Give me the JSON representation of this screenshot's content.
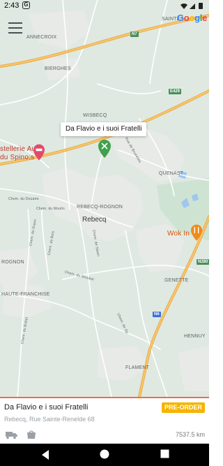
{
  "status_bar": {
    "time": "2:43",
    "notification_icon": "g-badge-icon",
    "right_icons": [
      "wifi-icon",
      "signal-icon",
      "battery-icon"
    ]
  },
  "map": {
    "attribution": "Google",
    "menu_icon": "hamburger-menu-icon",
    "places": {
      "annecroix": "ANNECROIX",
      "bierghes": "BIERGHES",
      "wisbecq": "WISBECQ",
      "saintes": "SAINTES",
      "hostellerie_line1": "stellerie Au",
      "hostellerie_line2": "du Spino:s",
      "quenast": "QUENAST",
      "rebecq_rognon": "REBECQ-ROGNON",
      "rebecq": "Rebecq",
      "rognon": "ROGNON",
      "wok_in": "Wok In",
      "genette": "GENETTE",
      "haute_franchise": "HAUTE-FRANCHISE",
      "hennuy": "HENNUY",
      "flament": "FLAMENT",
      "chem_douaire": "Chem. du Douaire",
      "chem_moulin": "Chem. du Moulin",
      "rue_bruxelles": "Rue de Bruxelles",
      "chem_sraux": "Chem. du Sraux",
      "chem_steen": "Chem. de Steen",
      "chem_bois": "Chem. du Bois",
      "chem_stoubet": "Chem. du Stoubet",
      "chem_brulet": "Chem. du Brûlet",
      "chem_sp": "Chem. de Sp"
    },
    "road_badges": {
      "n7": "N7",
      "e429": "E429",
      "n280": "N280",
      "n6": "N6"
    },
    "selected_restaurant_label": "Da Flavio e i suoi Fratelli",
    "colors": {
      "map_background": "#dfe9e2",
      "highway": "#f6c56a",
      "highway_edge": "#e7a23b",
      "urban": "#e9ebe8",
      "water": "#9fc6f2",
      "pin_green": "#3fa14b",
      "pin_orange": "#f08a1c",
      "pin_pink": "#e24a6b"
    }
  },
  "card": {
    "restaurant_name": "Da Flavio e i suoi Fratelli",
    "address": "Rebecq, Rue Sainte-Renelde 68",
    "preorder_label": "PRE-ORDER",
    "distance": "7537.5 km",
    "icons": [
      "delivery-truck-icon",
      "takeaway-bag-icon"
    ],
    "accent_color": "#ef6c4a",
    "preorder_color": "#f5b400"
  },
  "navbar": {
    "buttons": [
      "back-icon",
      "home-icon",
      "recents-icon"
    ]
  }
}
